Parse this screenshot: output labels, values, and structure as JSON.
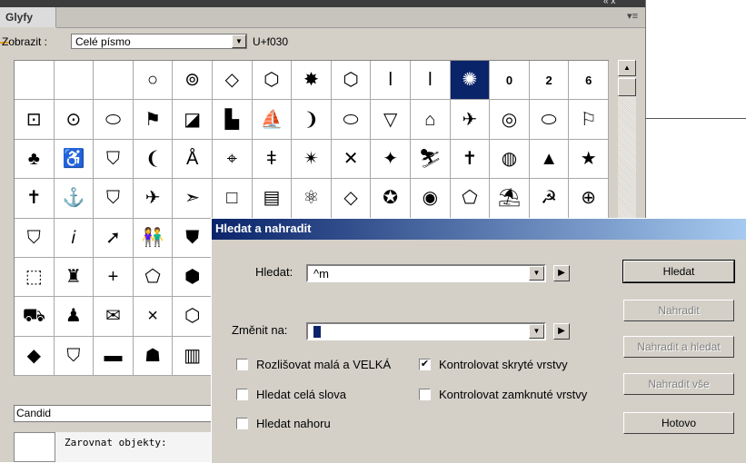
{
  "panel": {
    "tab_label": "Glyfy",
    "window_controls": "« x",
    "menu_icon": "▾≡",
    "show_label": "Zobrazit :",
    "show_value": "Celé písmo",
    "unicode": "U+f030",
    "selected_cell": 11,
    "glyphs": [
      "",
      "",
      "",
      "○",
      "⊚",
      "◇",
      "⬡",
      "✸",
      "⬡",
      "ǀ",
      "ǀ",
      "✺",
      "0",
      "2",
      "6",
      "⊡",
      "⊙",
      "⬭",
      "⚑",
      "◪",
      "▙",
      "⛵",
      "❩",
      "⬭",
      "▽",
      "⌂",
      "✈",
      "◎",
      "⬭",
      "⚐",
      "♣",
      "♿",
      "⛉",
      "❨",
      "Å",
      "⌖",
      "ǂ",
      "✴",
      "✕",
      "✦",
      "⛷",
      "✝",
      "◍",
      "▲",
      "★",
      "✝",
      "⚓",
      "⛉",
      "✈",
      "➣",
      "□",
      "▤",
      "⚛",
      "◇",
      "✪",
      "◉",
      "⬠",
      "⛱",
      "☭",
      "⊕",
      "⛉",
      "𝑖",
      "➚",
      "👫",
      "⛊",
      "",
      "",
      "",
      "",
      "",
      "",
      "",
      "",
      "",
      "",
      "⬚",
      "♜",
      "+",
      "⬠",
      "⬢",
      "",
      "",
      "",
      "",
      "",
      "",
      "",
      "",
      "",
      "",
      "⛟",
      "♟",
      "✉",
      "×",
      "⬡",
      "",
      "",
      "",
      "",
      "",
      "",
      "",
      "",
      "",
      "",
      "◆",
      "⛉",
      "▬",
      "☗",
      "▥",
      "",
      "",
      "",
      "",
      "",
      "",
      "",
      "",
      "",
      ""
    ],
    "font_name": "Candid",
    "align_label": "Zarovnat objekty:"
  },
  "dialog": {
    "title": "Hledat a nahradit",
    "find_label": "Hledat:",
    "find_value": "^m",
    "replace_label": "Změnit na:",
    "replace_value": "",
    "options": [
      {
        "label": "Rozlišovat malá a VELKÁ",
        "checked": false
      },
      {
        "label": "Kontrolovat skryté vrstvy",
        "checked": true
      },
      {
        "label": "Hledat celá slova",
        "checked": false
      },
      {
        "label": "Kontrolovat zamknuté vrstvy",
        "checked": false
      },
      {
        "label": "Hledat nahoru",
        "checked": false
      }
    ],
    "buttons": {
      "find": "Hledat",
      "replace": "Nahradit",
      "replace_find": "Nahradit a hledat",
      "replace_all": "Nahradit vše",
      "done": "Hotovo"
    }
  }
}
